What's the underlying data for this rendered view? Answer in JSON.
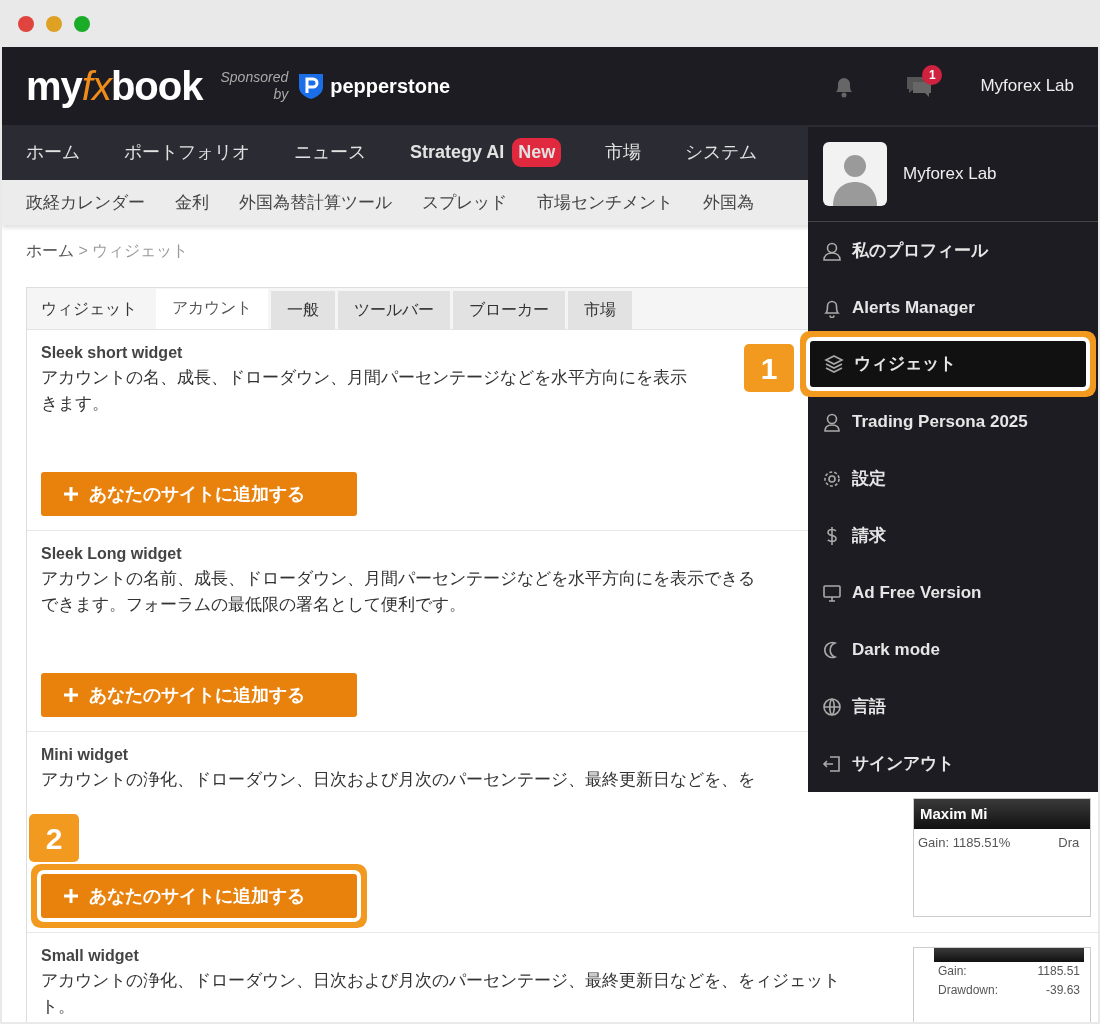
{
  "header": {
    "logo": {
      "pre": "my",
      "accent": "fx",
      "post": "book"
    },
    "sponsor_label": "Sponsored",
    "sponsor_by": "by",
    "sponsor_name": "pepperstone",
    "messages_count": "1",
    "user_name": "Myforex Lab"
  },
  "main_nav": [
    {
      "label": "ホーム",
      "bold": false
    },
    {
      "label": "ポートフォリオ",
      "bold": false
    },
    {
      "label": "ニュース",
      "bold": false
    },
    {
      "label": "Strategy AI",
      "bold": true,
      "badge": "New"
    },
    {
      "label": "市場",
      "bold": false
    },
    {
      "label": "システム",
      "bold": false
    }
  ],
  "sub_nav": [
    "政経カレンダー",
    "金利",
    "外国為替計算ツール",
    "スプレッド",
    "市場センチメント",
    "外国為"
  ],
  "breadcrumb": {
    "home": "ホーム",
    "separator": ">",
    "current": "ウィジェット"
  },
  "panel": {
    "title": "ウィジェット",
    "tabs": [
      {
        "label": "アカウント",
        "selected": true
      },
      {
        "label": "一般",
        "selected": false
      },
      {
        "label": "ツールバー",
        "selected": false
      },
      {
        "label": "ブローカー",
        "selected": false
      },
      {
        "label": "市場",
        "selected": false
      }
    ]
  },
  "widgets": [
    {
      "title": "Sleek short widget",
      "description": [
        "アカウントの名、成長、ドローダウン、月間パーセンテージなどを水平方向にを表示",
        "きます。"
      ],
      "button": "あなたのサイトに追加する"
    },
    {
      "title": "Sleek Long widget",
      "description": [
        "アカウントの名前、成長、ドローダウン、月間パーセンテージなどを水平方向にを表示できる",
        "できます。フォーラムの最低限の署名として便利です。"
      ],
      "button": "あなたのサイトに追加する"
    },
    {
      "title": "Mini widget",
      "description": [
        "アカウントの浄化、ドローダウン、日次および月次のパーセンテージ、最終更新日などを、を"
      ],
      "button": "あなたのサイトに追加する",
      "callout": "2",
      "preview": {
        "kind": "mini",
        "title": "Maxim Mi",
        "rows": [
          [
            "Gain: 1185.51%",
            "Dra"
          ]
        ]
      }
    },
    {
      "title": "Small widget",
      "description": [
        "アカウントの浄化、ドローダウン、日次および月次のパーセンテージ、最終更新日などを、をィジェット",
        "ト。"
      ],
      "preview": {
        "kind": "small",
        "rows": [
          [
            "Gain:",
            "1185.51"
          ],
          [
            "Drawdown:",
            "-39.63"
          ]
        ]
      }
    }
  ],
  "user_menu": {
    "name": "Myforex Lab",
    "items": [
      {
        "label": "私のプロフィール"
      },
      {
        "label": "Alerts Manager"
      },
      {
        "label": "ウィジェット",
        "callout": "1"
      },
      {
        "label": "Trading Persona 2025"
      },
      {
        "label": "設定"
      },
      {
        "label": "請求"
      },
      {
        "label": "Ad Free Version"
      },
      {
        "label": "Dark mode"
      },
      {
        "label": "言語"
      },
      {
        "label": "サインアウト"
      }
    ]
  }
}
